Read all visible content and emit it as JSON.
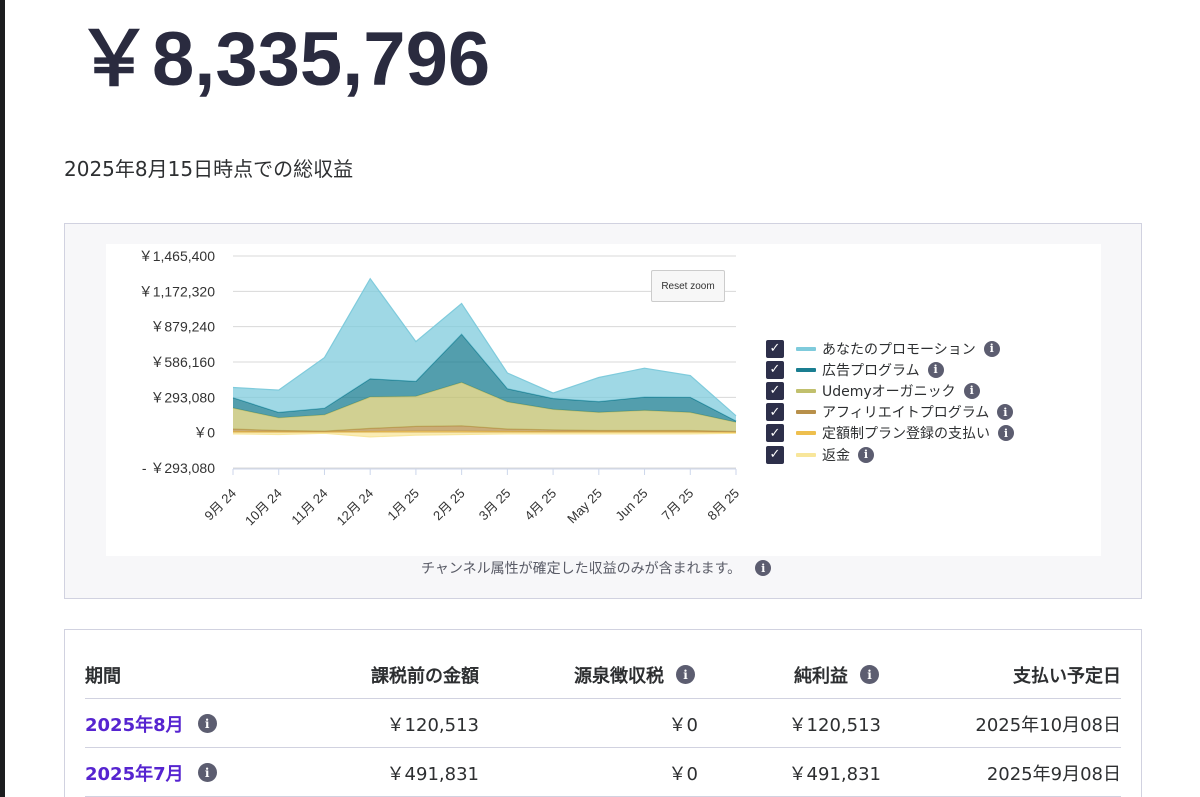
{
  "summary": {
    "total_revenue": "￥8,335,796",
    "as_of": "2025年8月15日時点での総収益"
  },
  "chart": {
    "reset_zoom_label": "Reset zoom",
    "note": "チャンネル属性が確定した収益のみが含まれます。",
    "legend": [
      {
        "label": "あなたのプロモーション",
        "color": "#7fcbdc"
      },
      {
        "label": "広告プログラム",
        "color": "#1a7e91"
      },
      {
        "label": "Udemyオーガニック",
        "color": "#c1c06d"
      },
      {
        "label": "アフィリエイトプログラム",
        "color": "#b8904a"
      },
      {
        "label": "定額制プラン登録の支払い",
        "color": "#eebf4e"
      },
      {
        "label": "返金",
        "color": "#f8e69b"
      }
    ]
  },
  "chart_data": {
    "type": "area",
    "title": "",
    "xlabel": "",
    "ylabel": "",
    "x": [
      "9月 24",
      "10月 24",
      "11月 24",
      "12月 24",
      "1月 25",
      "2月 25",
      "3月 25",
      "4月 25",
      "May 25",
      "Jun 25",
      "7月 25",
      "8月 25"
    ],
    "ylim": [
      -293080,
      1465400
    ],
    "yticks": [
      "￥1,465,400",
      "￥1,172,320",
      "￥879,240",
      "￥586,160",
      "￥293,080",
      "￥0",
      "- ￥293,080"
    ],
    "stacked": true,
    "series": [
      {
        "name": "返金",
        "color": "#f8e69b",
        "values": [
          -10000,
          -15000,
          -5000,
          -35000,
          -20000,
          -15000,
          -10000,
          -10000,
          -10000,
          -10000,
          -10000,
          -5000
        ]
      },
      {
        "name": "定額制プラン登録の支払い",
        "color": "#eebf4e",
        "values": [
          10000,
          8000,
          8000,
          10000,
          12000,
          12000,
          10000,
          8000,
          8000,
          8000,
          8000,
          5000
        ]
      },
      {
        "name": "アフィリエイトプログラム",
        "color": "#b8904a",
        "values": [
          20000,
          10000,
          5000,
          25000,
          40000,
          45000,
          20000,
          15000,
          10000,
          10000,
          10000,
          5000
        ]
      },
      {
        "name": "Udemyオーガニック",
        "color": "#c1c06d",
        "values": [
          175000,
          105000,
          135000,
          262000,
          250000,
          360000,
          225000,
          170000,
          150000,
          167000,
          150000,
          77000
        ]
      },
      {
        "name": "広告プログラム",
        "color": "#1a7e91",
        "values": [
          85000,
          45000,
          55000,
          150000,
          123000,
          400000,
          110000,
          90000,
          90000,
          110000,
          125000,
          10000
        ]
      },
      {
        "name": "あなたのプロモーション",
        "color": "#7fcbdc",
        "values": [
          85000,
          185000,
          420000,
          830000,
          330000,
          254000,
          130000,
          45000,
          200000,
          240000,
          180000,
          43000
        ]
      }
    ]
  },
  "table": {
    "headers": {
      "period": "期間",
      "pretax": "課税前の金額",
      "withholding": "源泉徴収税",
      "net": "純利益",
      "payout_date": "支払い予定日"
    },
    "rows": [
      {
        "period": "2025年8月",
        "pretax": "￥120,513",
        "withholding": "￥0",
        "net": "￥120,513",
        "payout_date": "2025年10月08日"
      },
      {
        "period": "2025年7月",
        "pretax": "￥491,831",
        "withholding": "￥0",
        "net": "￥491,831",
        "payout_date": "2025年9月08日"
      }
    ]
  }
}
